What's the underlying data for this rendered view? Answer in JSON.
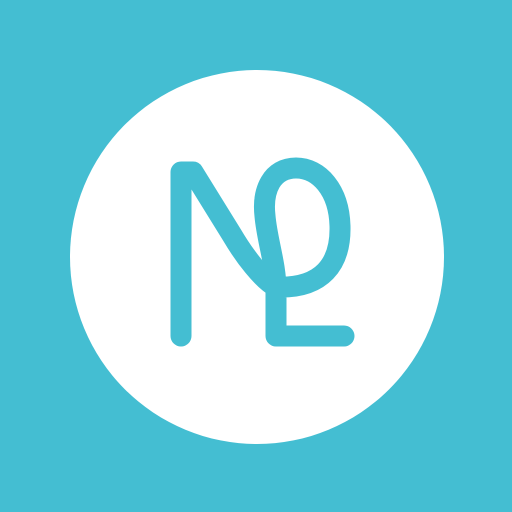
{
  "colors": {
    "background": "#44BED2",
    "badge": "#FFFFFF",
    "glyph": "#44BED2"
  },
  "icon": {
    "name": "monogram-nl-logo"
  }
}
